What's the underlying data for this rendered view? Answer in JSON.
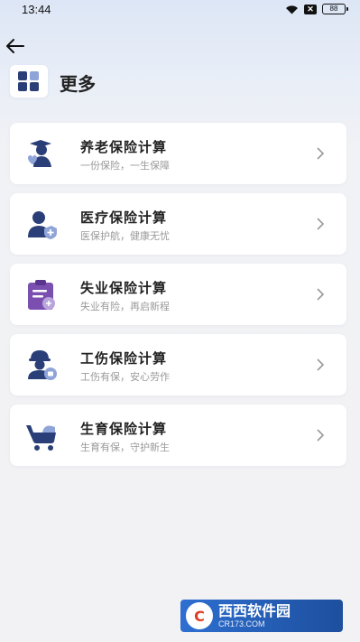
{
  "status_bar": {
    "time": "13:44",
    "battery": "88",
    "icons": [
      "wifi-icon",
      "x-icon",
      "battery-icon"
    ]
  },
  "header": {
    "title": "更多",
    "icon": "grid-apps-icon"
  },
  "cards": [
    {
      "title": "养老保险计算",
      "subtitle": "一份保险，一生保障",
      "icon": "pension-icon"
    },
    {
      "title": "医疗保险计算",
      "subtitle": "医保护航，健康无忧",
      "icon": "medical-icon"
    },
    {
      "title": "失业保险计算",
      "subtitle": "失业有险，再启新程",
      "icon": "unemployment-icon"
    },
    {
      "title": "工伤保险计算",
      "subtitle": "工伤有保，安心劳作",
      "icon": "work-injury-icon"
    },
    {
      "title": "生育保险计算",
      "subtitle": "生育有保，守护新生",
      "icon": "maternity-icon"
    }
  ],
  "colors": {
    "accent_dark": "#2a3f77",
    "accent_purple": "#7b4fb0",
    "accent_light": "#8fa4d8",
    "card_bg": "#ffffff",
    "subtitle_gray": "#9a9a9a"
  },
  "watermark": {
    "brand": "西西软件园",
    "url": "CR173.COM",
    "logo_text": "C"
  }
}
